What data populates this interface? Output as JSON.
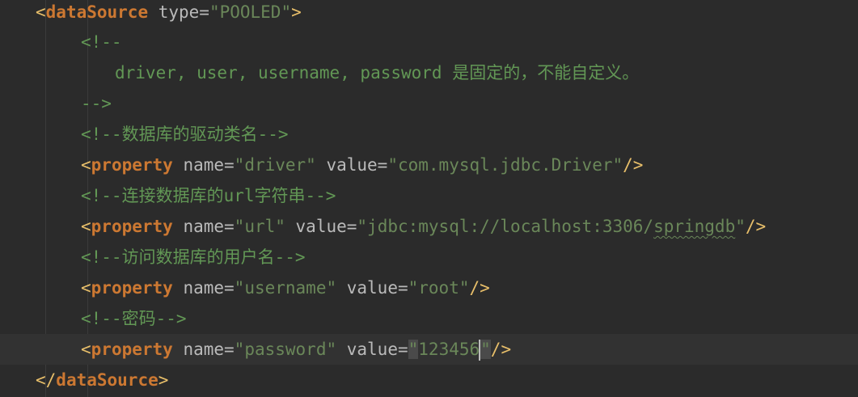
{
  "editor": {
    "lines": {
      "l1": {
        "open": "<",
        "tag": "dataSource",
        "attr": " type=",
        "val": "\"POOLED\"",
        "close": ">"
      },
      "l2": {
        "text": "<!--"
      },
      "l3": {
        "text": "driver, user, username, password 是固定的，不能自定义。"
      },
      "l4": {
        "text": "-->"
      },
      "l5": {
        "text": "<!--数据库的驱动类名-->"
      },
      "l6": {
        "open": "<",
        "tag": "property",
        "attr1": " name=",
        "val1": "\"driver\"",
        "attr2": " value=",
        "val2": "\"com.mysql.jdbc.Driver\"",
        "close": "/>"
      },
      "l7": {
        "text": "<!--连接数据库的url字符串-->"
      },
      "l8": {
        "open": "<",
        "tag": "property",
        "attr1": " name=",
        "val1": "\"url\"",
        "attr2": " value=",
        "val2a": "\"jdbc:mysql://localhost:3306/",
        "val2b": "springdb",
        "val2c": "\"",
        "close": "/>"
      },
      "l9": {
        "text": "<!--访问数据库的用户名-->"
      },
      "l10": {
        "open": "<",
        "tag": "property",
        "attr1": " name=",
        "val1": "\"username\"",
        "attr2": " value=",
        "val2": "\"root\"",
        "close": "/>"
      },
      "l11": {
        "text": "<!--密码-->"
      },
      "l12": {
        "open": "<",
        "tag": "property",
        "attr1": " name=",
        "val1": "\"password\"",
        "attr2": " value=",
        "q1": "\"",
        "val2": "123456",
        "q2": "\"",
        "close": "/>"
      },
      "l13": {
        "open": "</",
        "tag": "dataSource",
        "close": ">"
      }
    }
  }
}
